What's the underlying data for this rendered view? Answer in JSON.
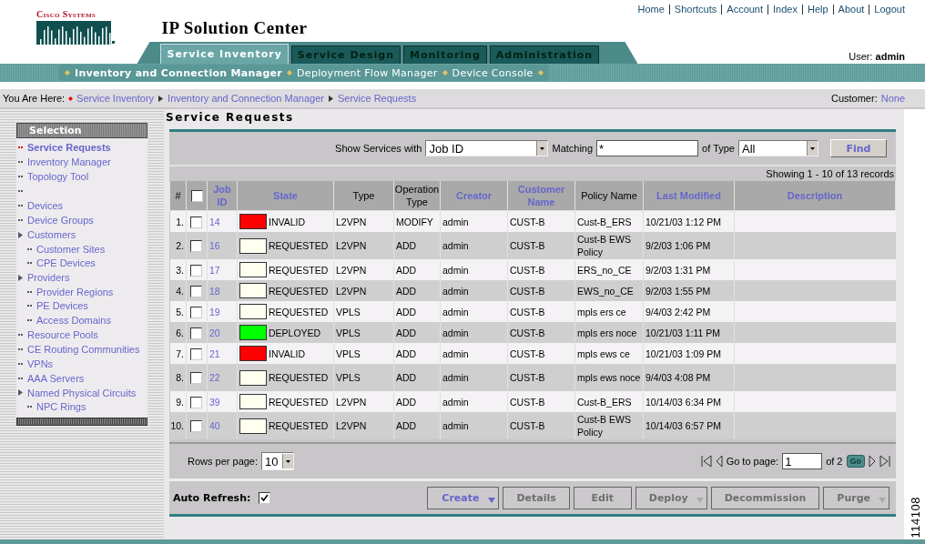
{
  "logo": {
    "text": "Cisco Systems"
  },
  "app_title": "IP Solution Center",
  "top_links": [
    "Home",
    "Shortcuts",
    "Account",
    "Index",
    "Help",
    "About",
    "Logout"
  ],
  "tabs": [
    {
      "label": "Service Inventory",
      "selected": true
    },
    {
      "label": "Service Design",
      "selected": false
    },
    {
      "label": "Monitoring",
      "selected": false
    },
    {
      "label": "Administration",
      "selected": false
    }
  ],
  "user": {
    "label": "User:",
    "name": "admin"
  },
  "subnav": [
    {
      "label": "Inventory and Connection Manager",
      "selected": true
    },
    {
      "label": "Deployment Flow Manager",
      "selected": false
    },
    {
      "label": "Device Console",
      "selected": false
    }
  ],
  "breadcrumb": {
    "label": "You Are Here:",
    "items": [
      "Service Inventory",
      "Inventory and Connection Manager",
      "Service Requests"
    ],
    "customer_label": "Customer:",
    "customer": "None"
  },
  "sidebar": {
    "title": "Selection",
    "items": [
      {
        "label": "Service Requests",
        "selected": true
      },
      {
        "label": "Inventory Manager",
        "selected": false
      },
      {
        "label": "Topology Tool",
        "selected": false
      },
      {
        "selected": false
      },
      {
        "label": "Devices",
        "selected": false
      },
      {
        "label": "Device Groups",
        "selected": false
      },
      {
        "label": "Customers",
        "selected": false,
        "children": [
          {
            "label": "Customer Sites",
            "selected": false
          },
          {
            "label": "CPE Devices",
            "selected": false
          }
        ]
      },
      {
        "label": "Providers",
        "selected": false,
        "children": [
          {
            "label": "Provider Regions",
            "selected": false
          },
          {
            "label": "PE Devices",
            "selected": false
          },
          {
            "label": "Access Domains",
            "selected": false
          }
        ]
      },
      {
        "label": "Resource Pools",
        "selected": false
      },
      {
        "label": "CE Routing Communities",
        "selected": false
      },
      {
        "label": "VPNs",
        "selected": false
      },
      {
        "label": "AAA Servers",
        "selected": false
      },
      {
        "label": "Named Physical Circuits",
        "selected": false,
        "children": [
          {
            "label": "NPC Rings",
            "selected": false
          }
        ]
      }
    ]
  },
  "page_title": "Service Requests",
  "filter": {
    "show_label": "Show Services with",
    "show_value": "Job ID",
    "matching_label": "Matching",
    "matching_value": "*",
    "type_label": "of Type",
    "type_value": "All",
    "find": "Find"
  },
  "records": "Showing 1 - 10 of 13 records",
  "table": {
    "columns": [
      {
        "label": "#",
        "sortable": false
      },
      {
        "kind": "checkbox",
        "checked": false
      },
      {
        "label": "Job ID",
        "sortable": true
      },
      {
        "label": "State",
        "sortable": true
      },
      {
        "label": "Type",
        "sortable": false
      },
      {
        "label": "Operation Type",
        "sortable": false
      },
      {
        "label": "Creator",
        "sortable": true
      },
      {
        "label": "Customer Name",
        "sortable": true
      },
      {
        "label": "Policy Name",
        "sortable": false
      },
      {
        "label": "Last Modified",
        "sortable": true
      },
      {
        "label": "Description",
        "sortable": true
      }
    ],
    "rows": [
      {
        "index": "1.",
        "checked": false,
        "job_id": "14",
        "color": "#ff0000",
        "state": "INVALID",
        "type": "L2VPN",
        "operation": "MODIFY",
        "creator": "admin",
        "customer": "CUST-B",
        "policy": "Cust-B_ERS",
        "modified": "10/21/03 1:12 PM"
      },
      {
        "index": "2.",
        "checked": false,
        "job_id": "16",
        "color": "#fffff0",
        "state": "REQUESTED",
        "type": "L2VPN",
        "operation": "ADD",
        "creator": "admin",
        "customer": "CUST-B",
        "policy": "Cust-B EWS Policy",
        "modified": "9/2/03 1:06 PM"
      },
      {
        "index": "3.",
        "checked": false,
        "job_id": "17",
        "color": "#fffff0",
        "state": "REQUESTED",
        "type": "L2VPN",
        "operation": "ADD",
        "creator": "admin",
        "customer": "CUST-B",
        "policy": "ERS_no_CE",
        "modified": "9/2/03 1:31 PM"
      },
      {
        "index": "4.",
        "checked": false,
        "job_id": "18",
        "color": "#fffff0",
        "state": "REQUESTED",
        "type": "L2VPN",
        "operation": "ADD",
        "creator": "admin",
        "customer": "CUST-B",
        "policy": "EWS_no_CE",
        "modified": "9/2/03 1:55 PM"
      },
      {
        "index": "5.",
        "checked": false,
        "job_id": "19",
        "color": "#fffff0",
        "state": "REQUESTED",
        "type": "VPLS",
        "operation": "ADD",
        "creator": "admin",
        "customer": "CUST-B",
        "policy": "mpls ers ce",
        "modified": "9/4/03 2:42 PM"
      },
      {
        "index": "6.",
        "checked": false,
        "job_id": "20",
        "color": "#00ff00",
        "state": "DEPLOYED",
        "type": "VPLS",
        "operation": "ADD",
        "creator": "admin",
        "customer": "CUST-B",
        "policy": "mpls ers noce",
        "modified": "10/21/03 1:11 PM"
      },
      {
        "index": "7.",
        "checked": false,
        "job_id": "21",
        "color": "#ff0000",
        "state": "INVALID",
        "type": "VPLS",
        "operation": "ADD",
        "creator": "admin",
        "customer": "CUST-B",
        "policy": "mpls ews ce",
        "modified": "10/21/03 1:09 PM"
      },
      {
        "index": "8.",
        "checked": false,
        "job_id": "22",
        "color": "#fffff0",
        "state": "REQUESTED",
        "type": "VPLS",
        "operation": "ADD",
        "creator": "admin",
        "customer": "CUST-B",
        "policy": "mpls ews noce",
        "modified": "9/4/03 4:08 PM"
      },
      {
        "index": "9.",
        "checked": false,
        "job_id": "39",
        "color": "#fffff0",
        "state": "REQUESTED",
        "type": "L2VPN",
        "operation": "ADD",
        "creator": "admin",
        "customer": "CUST-B",
        "policy": "Cust-B_ERS",
        "modified": "10/14/03 6:34 PM"
      },
      {
        "index": "10.",
        "checked": false,
        "job_id": "40",
        "color": "#fffff0",
        "state": "REQUESTED",
        "type": "L2VPN",
        "operation": "ADD",
        "creator": "admin",
        "customer": "CUST-B",
        "policy": "Cust-B EWS Policy",
        "modified": "10/14/03 6:57 PM"
      }
    ]
  },
  "pager": {
    "rows_label": "Rows per page:",
    "rows_value": "10",
    "goto_label": "Go to page:",
    "page": "1",
    "of": "of 2",
    "go": "Go"
  },
  "auto_refresh": {
    "label": "Auto Refresh:",
    "checked": true
  },
  "actions": [
    {
      "label": "Create",
      "disabled": false,
      "menu": true
    },
    {
      "label": "Details",
      "disabled": true,
      "menu": false
    },
    {
      "label": "Edit",
      "disabled": true,
      "menu": false
    },
    {
      "label": "Deploy",
      "disabled": true,
      "menu": true
    },
    {
      "label": "Decommission",
      "disabled": true,
      "menu": false
    },
    {
      "label": "Purge",
      "disabled": true,
      "menu": true
    }
  ],
  "figure_number": "114108"
}
